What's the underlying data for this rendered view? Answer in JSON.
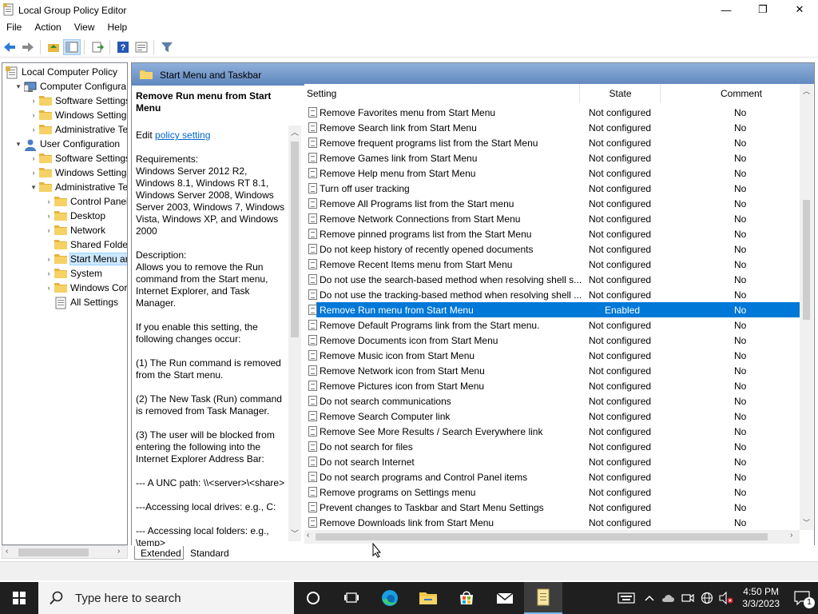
{
  "window": {
    "title": "Local Group Policy Editor",
    "minimize": "—",
    "maximize": "❐",
    "close": "✕"
  },
  "menu": [
    "File",
    "Action",
    "View",
    "Help"
  ],
  "tree": {
    "items": [
      {
        "label": "Local Computer Policy",
        "level": 0,
        "exp": "",
        "icon": "policy"
      },
      {
        "label": "Computer Configura",
        "level": 1,
        "exp": "▾",
        "icon": "computer"
      },
      {
        "label": "Software Settings",
        "level": 2,
        "exp": "›",
        "icon": "folder"
      },
      {
        "label": "Windows Setting",
        "level": 2,
        "exp": "›",
        "icon": "folder"
      },
      {
        "label": "Administrative Te",
        "level": 2,
        "exp": "›",
        "icon": "folder"
      },
      {
        "label": "User Configuration",
        "level": 1,
        "exp": "▾",
        "icon": "user"
      },
      {
        "label": "Software Settings",
        "level": 2,
        "exp": "›",
        "icon": "folder"
      },
      {
        "label": "Windows Setting",
        "level": 2,
        "exp": "›",
        "icon": "folder"
      },
      {
        "label": "Administrative Te",
        "level": 2,
        "exp": "▾",
        "icon": "folder"
      },
      {
        "label": "Control Panel",
        "level": 3,
        "exp": "›",
        "icon": "folder"
      },
      {
        "label": "Desktop",
        "level": 3,
        "exp": "›",
        "icon": "folder"
      },
      {
        "label": "Network",
        "level": 3,
        "exp": "›",
        "icon": "folder"
      },
      {
        "label": "Shared Folder",
        "level": 3,
        "exp": "",
        "icon": "folder"
      },
      {
        "label": "Start Menu ar",
        "level": 3,
        "exp": "›",
        "icon": "folder",
        "selected": true
      },
      {
        "label": "System",
        "level": 3,
        "exp": "›",
        "icon": "folder"
      },
      {
        "label": "Windows Cor",
        "level": 3,
        "exp": "›",
        "icon": "folder"
      },
      {
        "label": "All Settings",
        "level": 3,
        "exp": "",
        "icon": "settings"
      }
    ]
  },
  "header": {
    "title": "Start Menu and Taskbar"
  },
  "desc": {
    "title": "Remove Run menu from Start Menu",
    "edit_prefix": "Edit ",
    "edit_link": "policy setting",
    "requirements": "Requirements:\nWindows Server 2012 R2, Windows 8.1, Windows RT 8.1, Windows Server 2008, Windows Server 2003, Windows 7, Windows Vista, Windows XP, and Windows 2000",
    "description": "Description:\nAllows you to remove the Run command from the Start menu, Internet Explorer, and Task Manager.",
    "p1": "If you enable this setting, the following changes occur:",
    "p2": "(1) The Run command is removed from the Start menu.",
    "p3": "(2) The New Task (Run) command is removed from Task Manager.",
    "p4": "(3) The user will be blocked from entering the following into the Internet Explorer Address Bar:",
    "p5": "--- A UNC path: \\\\<server>\\<share>",
    "p6": "---Accessing local drives:  e.g., C:",
    "p7": "--- Accessing local folders: e.g., \\temp>"
  },
  "columns": {
    "setting": "Setting",
    "state": "State",
    "comment": "Comment"
  },
  "rows": [
    {
      "setting": "Remove Favorites menu from Start Menu",
      "state": "Not configured",
      "comment": "No"
    },
    {
      "setting": "Remove Search link from Start Menu",
      "state": "Not configured",
      "comment": "No"
    },
    {
      "setting": "Remove frequent programs list from the Start Menu",
      "state": "Not configured",
      "comment": "No"
    },
    {
      "setting": "Remove Games link from Start Menu",
      "state": "Not configured",
      "comment": "No"
    },
    {
      "setting": "Remove Help menu from Start Menu",
      "state": "Not configured",
      "comment": "No"
    },
    {
      "setting": "Turn off user tracking",
      "state": "Not configured",
      "comment": "No"
    },
    {
      "setting": "Remove All Programs list from the Start menu",
      "state": "Not configured",
      "comment": "No"
    },
    {
      "setting": "Remove Network Connections from Start Menu",
      "state": "Not configured",
      "comment": "No"
    },
    {
      "setting": "Remove pinned programs list from the Start Menu",
      "state": "Not configured",
      "comment": "No"
    },
    {
      "setting": "Do not keep history of recently opened documents",
      "state": "Not configured",
      "comment": "No"
    },
    {
      "setting": "Remove Recent Items menu from Start Menu",
      "state": "Not configured",
      "comment": "No"
    },
    {
      "setting": "Do not use the search-based method when resolving shell s...",
      "state": "Not configured",
      "comment": "No"
    },
    {
      "setting": "Do not use the tracking-based method when resolving shell ...",
      "state": "Not configured",
      "comment": "No"
    },
    {
      "setting": "Remove Run menu from Start Menu",
      "state": "Enabled",
      "comment": "No",
      "selected": true
    },
    {
      "setting": "Remove Default Programs link from the Start menu.",
      "state": "Not configured",
      "comment": "No"
    },
    {
      "setting": "Remove Documents icon from Start Menu",
      "state": "Not configured",
      "comment": "No"
    },
    {
      "setting": "Remove Music icon from Start Menu",
      "state": "Not configured",
      "comment": "No"
    },
    {
      "setting": "Remove Network icon from Start Menu",
      "state": "Not configured",
      "comment": "No"
    },
    {
      "setting": "Remove Pictures icon from Start Menu",
      "state": "Not configured",
      "comment": "No"
    },
    {
      "setting": "Do not search communications",
      "state": "Not configured",
      "comment": "No"
    },
    {
      "setting": "Remove Search Computer link",
      "state": "Not configured",
      "comment": "No"
    },
    {
      "setting": "Remove See More Results / Search Everywhere link",
      "state": "Not configured",
      "comment": "No"
    },
    {
      "setting": "Do not search for files",
      "state": "Not configured",
      "comment": "No"
    },
    {
      "setting": "Do not search Internet",
      "state": "Not configured",
      "comment": "No"
    },
    {
      "setting": "Do not search programs and Control Panel items",
      "state": "Not configured",
      "comment": "No"
    },
    {
      "setting": "Remove programs on Settings menu",
      "state": "Not configured",
      "comment": "No"
    },
    {
      "setting": "Prevent changes to Taskbar and Start Menu Settings",
      "state": "Not configured",
      "comment": "No"
    },
    {
      "setting": "Remove Downloads link from Start Menu",
      "state": "Not configured",
      "comment": "No"
    }
  ],
  "tabs": {
    "extended": "Extended",
    "standard": "Standard"
  },
  "taskbar": {
    "search_placeholder": "Type here to search",
    "time": "4:50 PM",
    "date": "3/3/2023",
    "notification_count": "1"
  }
}
